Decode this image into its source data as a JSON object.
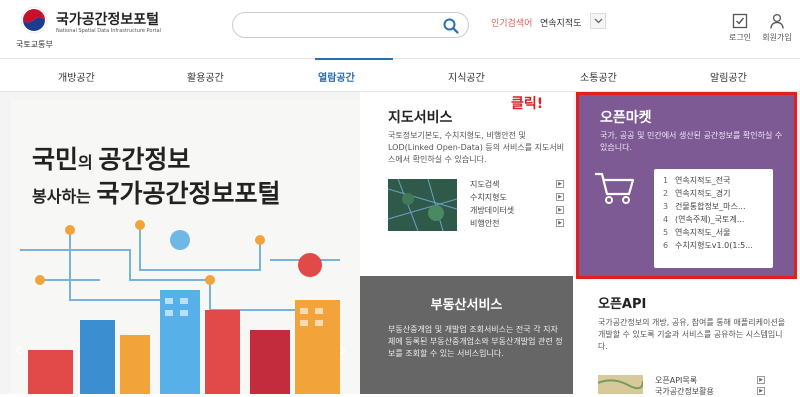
{
  "header": {
    "ministry": "국토교통부",
    "site_title": "국가공간정보포털",
    "site_subtitle": "National Spatial Data Infrastructure Portal",
    "search_placeholder": "",
    "popular_label": "인기검색어",
    "popular_term": "연속지적도",
    "login_label": "로그인",
    "signup_label": "회원가입"
  },
  "nav": {
    "items": [
      {
        "label": "개방공간"
      },
      {
        "label": "활용공간"
      },
      {
        "label": "열람공간"
      },
      {
        "label": "지식공간"
      },
      {
        "label": "소통공간"
      },
      {
        "label": "알림공간"
      }
    ],
    "active_index": 2
  },
  "hero": {
    "line1_a": "국민",
    "line1_b": "의 ",
    "line1_c": "공간정보",
    "line2_a": "봉사하는 ",
    "line2_b": "국가공간정보포털"
  },
  "map_service": {
    "title": "지도서비스",
    "desc": "국토정보기본도, 수치지형도, 비행안전 및 LOD(Linked Open-Data) 등의 서비스를 지도서비스에서 확인하실 수 있습니다.",
    "links": [
      "지도검색",
      "수치지형도",
      "개방데이터셋",
      "비행안전"
    ]
  },
  "real_estate": {
    "title": "부동산서비스",
    "desc": "부동산중개업 및 개발업 조회서비스는 전국 각 지자체에 등록된 부동산중개업소와 부동산개발업 관련 정보를 조회할 수 있는 서비스입니다."
  },
  "annotation": "클릭!",
  "open_market": {
    "title": "오픈마켓",
    "desc": "국가, 공공 및 민간에서 생산된 공간정보를 확인하실 수 있습니다.",
    "items": [
      {
        "num": "1",
        "label": "연속지적도_전국"
      },
      {
        "num": "2",
        "label": "연속지적도_경기"
      },
      {
        "num": "3",
        "label": "건물통합정보_마스..."
      },
      {
        "num": "4",
        "label": "(연속주제)_국토계..."
      },
      {
        "num": "5",
        "label": "연속지적도_서울"
      },
      {
        "num": "6",
        "label": "수치지형도v1.0(1:5..."
      }
    ]
  },
  "open_api": {
    "title": "오픈API",
    "desc": "국가공간정보의 개방, 공유, 참여를 통해 애플리케이션을 개발할 수 있도록 기술과 서비스를 공유하는 시스템입니다.",
    "links": [
      "오픈API목록",
      "국가공간정보활용"
    ]
  },
  "colors": {
    "accent": "#2a6fb0",
    "market_bg": "#7d5a93",
    "highlight": "#e02020",
    "realestate_bg": "#666666"
  }
}
